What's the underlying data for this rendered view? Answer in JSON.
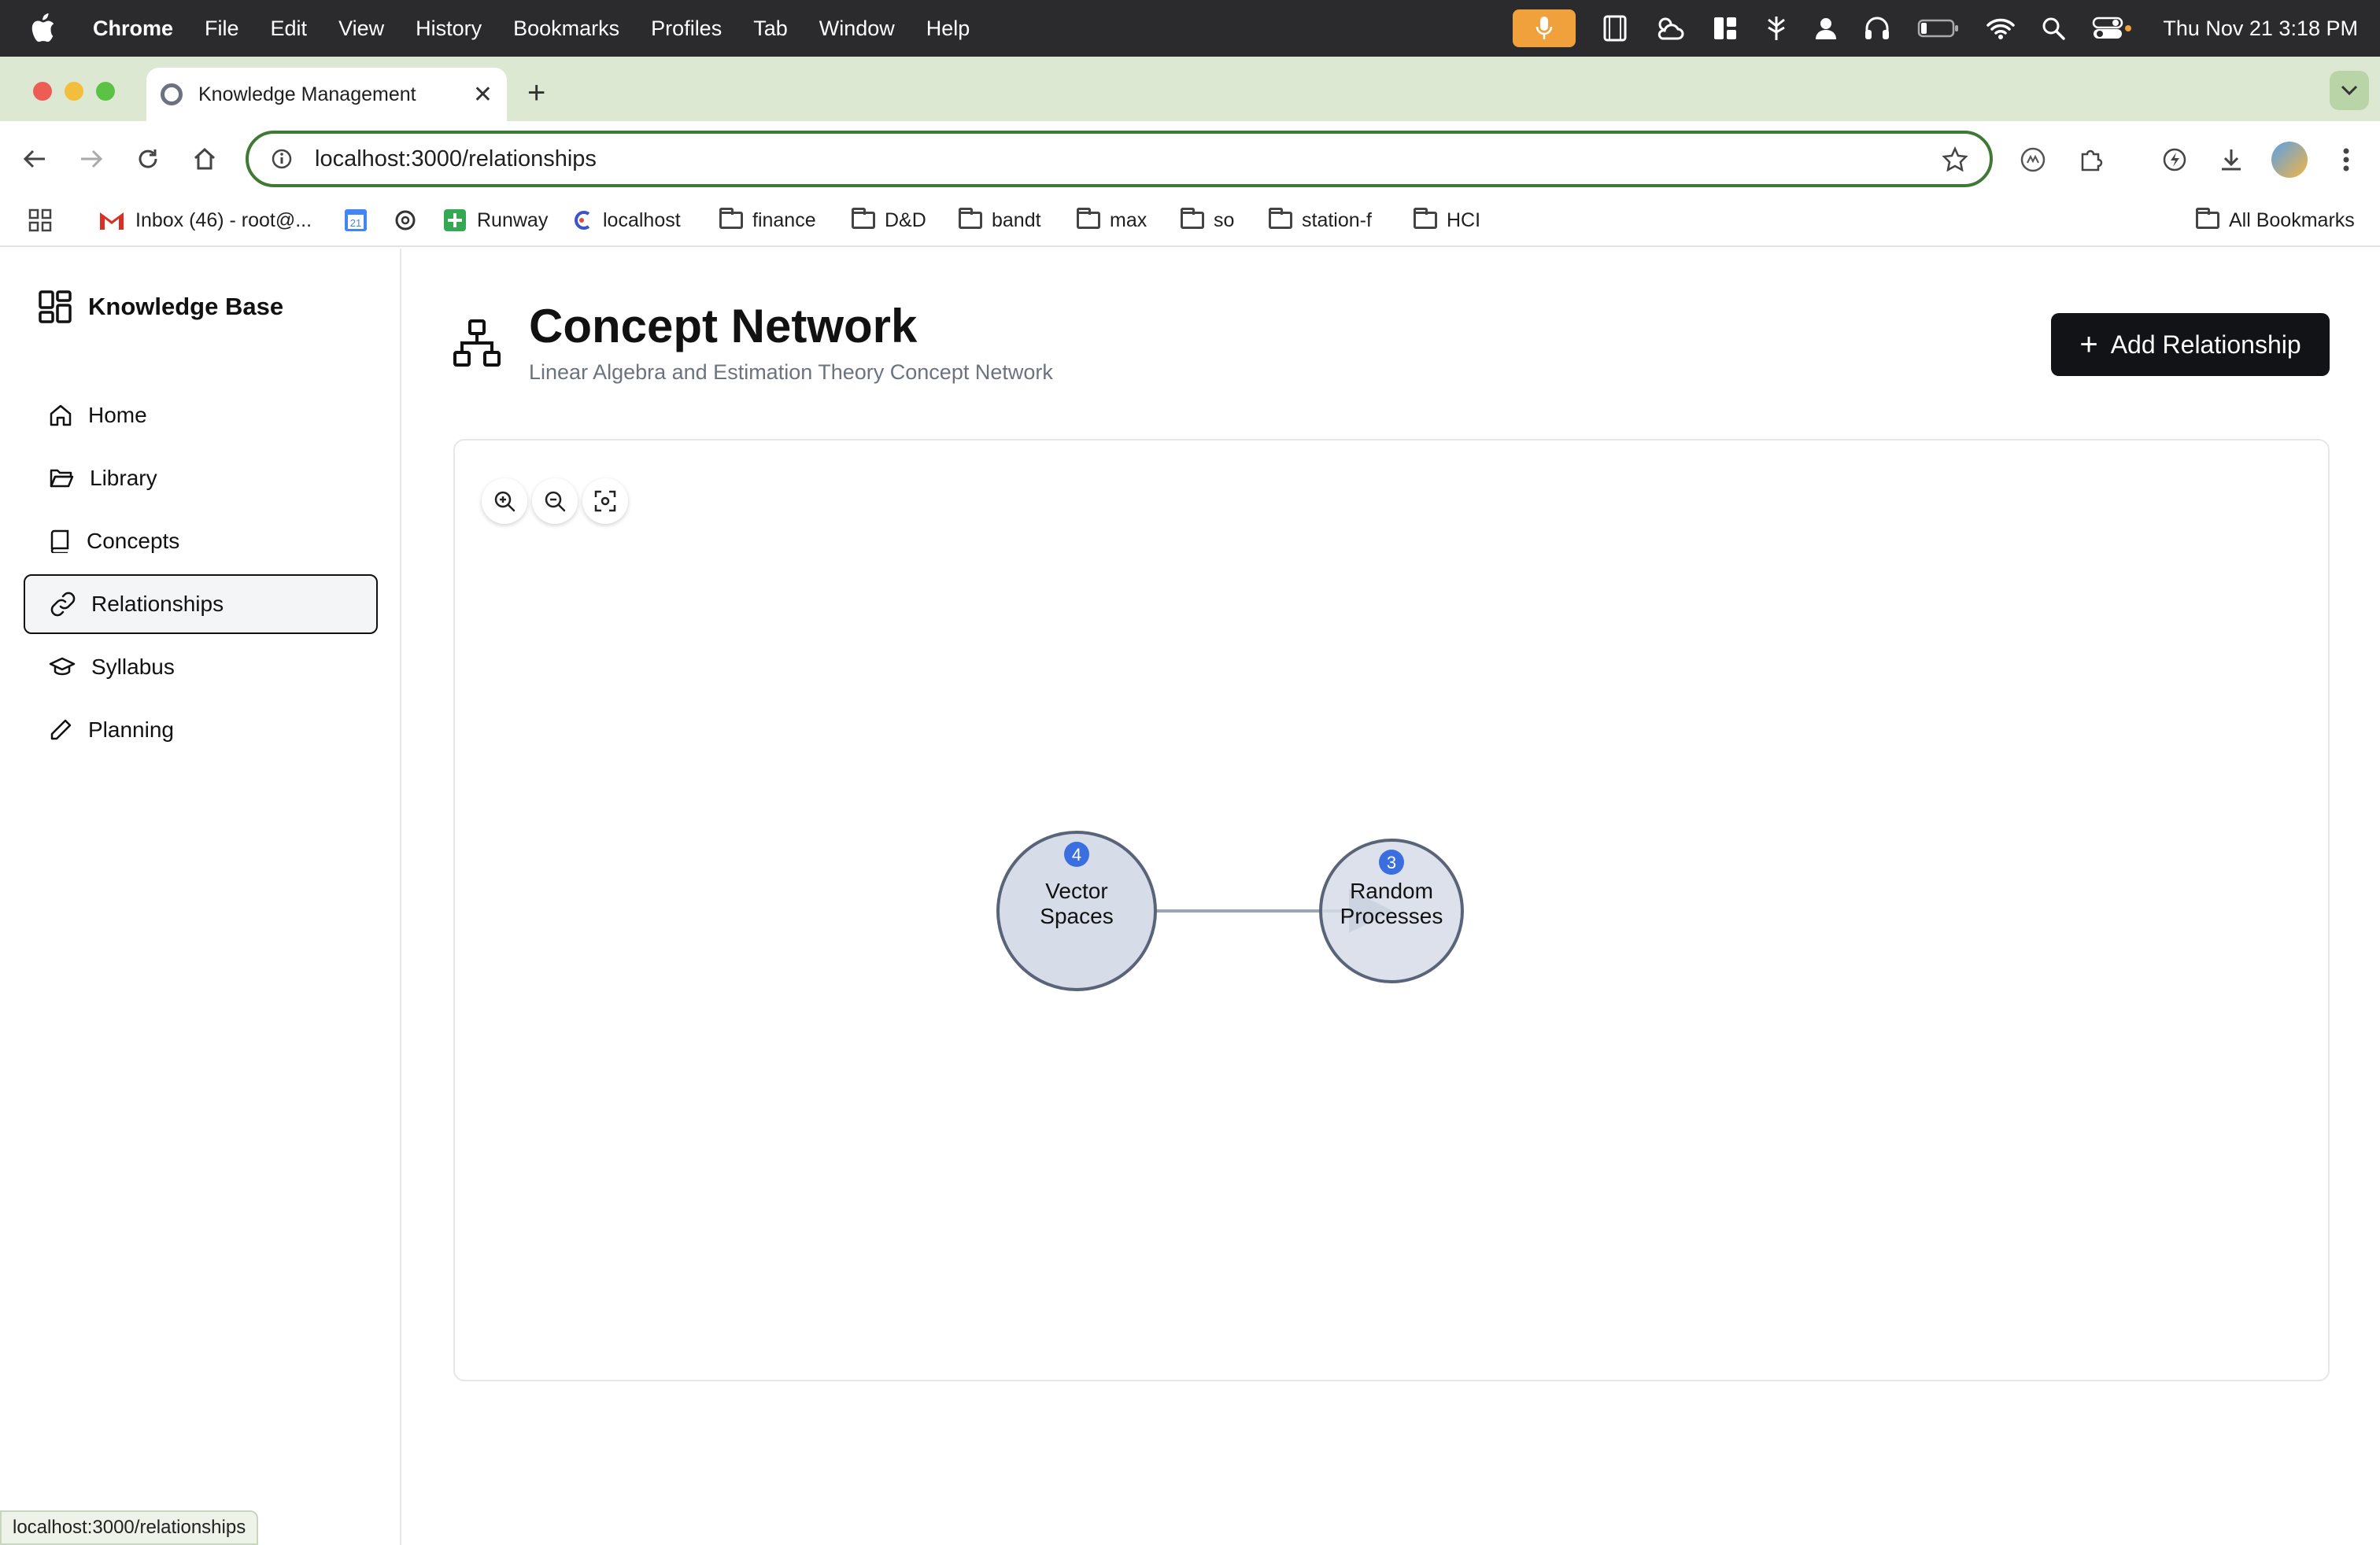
{
  "menubar": {
    "app_name": "Chrome",
    "items": [
      "File",
      "Edit",
      "View",
      "History",
      "Bookmarks",
      "Profiles",
      "Tab",
      "Window",
      "Help"
    ],
    "clock": "Thu Nov 21  3:18 PM",
    "status_icons": [
      "microphone-icon",
      "film-icon",
      "cloud-sun-icon",
      "window-layout-icon",
      "kiwi-icon",
      "user-icon",
      "headphones-icon",
      "battery-icon",
      "wifi-icon",
      "search-icon",
      "control-center-icon"
    ],
    "accent": "#f0a13c"
  },
  "browser": {
    "tab_title": "Knowledge Management",
    "url": "localhost:3000/relationships",
    "bookmarks": [
      {
        "label": "Inbox (46) - root@...",
        "icon": "gmail-icon"
      },
      {
        "label": "",
        "icon": "calendar-icon"
      },
      {
        "label": "",
        "icon": "openai-icon"
      },
      {
        "label": "Runway",
        "icon": "runway-icon"
      },
      {
        "label": "localhost",
        "icon": "localhost-icon"
      },
      {
        "label": "finance",
        "icon": "folder-icon"
      },
      {
        "label": "D&D",
        "icon": "folder-icon"
      },
      {
        "label": "bandt",
        "icon": "folder-icon"
      },
      {
        "label": "max",
        "icon": "folder-icon"
      },
      {
        "label": "so",
        "icon": "folder-icon"
      },
      {
        "label": "station-f",
        "icon": "folder-icon"
      },
      {
        "label": "HCI",
        "icon": "folder-icon"
      }
    ],
    "calendar_day": "21",
    "all_bookmarks": "All Bookmarks",
    "status_url": "localhost:3000/relationships",
    "frame_color": "#dce8d2"
  },
  "sidebar": {
    "brand": "Knowledge Base",
    "items": [
      {
        "label": "Home",
        "icon": "home-icon"
      },
      {
        "label": "Library",
        "icon": "folder-open-icon"
      },
      {
        "label": "Concepts",
        "icon": "book-icon"
      },
      {
        "label": "Relationships",
        "icon": "link-icon",
        "active": true
      },
      {
        "label": "Syllabus",
        "icon": "graduation-cap-icon"
      },
      {
        "label": "Planning",
        "icon": "pencil-icon"
      }
    ]
  },
  "main": {
    "title": "Concept Network",
    "subtitle": "Linear Algebra and Estimation Theory Concept Network",
    "add_button": "Add Relationship",
    "zoom_controls": [
      "zoom-in-icon",
      "zoom-out-icon",
      "fit-view-icon"
    ]
  },
  "graph": {
    "nodes": [
      {
        "id": "vector-spaces",
        "lines": [
          "Vector",
          "Spaces"
        ],
        "badge": "4"
      },
      {
        "id": "random-processes",
        "lines": [
          "Random",
          "Processes"
        ],
        "badge": "3"
      }
    ],
    "edges": [
      {
        "from": "vector-spaces",
        "to": "random-processes"
      }
    ],
    "node_fill": "#d6dce8",
    "node_stroke": "#5a6478",
    "badge_color": "#3b6fe0",
    "edge_color": "#9aa5b8"
  }
}
